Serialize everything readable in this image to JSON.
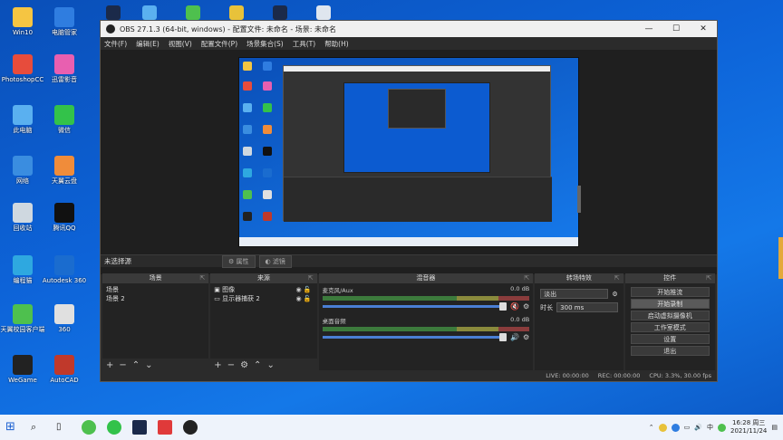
{
  "window": {
    "title": "OBS 27.1.3 (64-bit, windows) - 配置文件: 未命名 - 场景: 未命名",
    "minimize": "—",
    "maximize": "☐",
    "close": "✕"
  },
  "menu": [
    "文件(F)",
    "编辑(E)",
    "视图(V)",
    "配置文件(P)",
    "场景集合(S)",
    "工具(T)",
    "帮助(H)"
  ],
  "context_bar": {
    "no_source": "未选择源",
    "properties": "属性",
    "filters": "滤镜"
  },
  "scenes": {
    "title": "场景",
    "items": [
      "场景",
      "场景 2"
    ]
  },
  "sources": {
    "title": "来源",
    "items": [
      "图像",
      "显示器捕获 2"
    ]
  },
  "mixer": {
    "title": "混音器",
    "tracks": [
      {
        "name": "麦克风/Aux",
        "db": "0.0 dB",
        "muted": true
      },
      {
        "name": "桌面音频",
        "db": "0.0 dB",
        "muted": false
      }
    ]
  },
  "transitions": {
    "title": "转场特效",
    "selected": "淡出",
    "duration_label": "时长",
    "duration_value": "300 ms"
  },
  "controls": {
    "title": "控件",
    "buttons": [
      "开始推流",
      "开始录制",
      "启动虚拟摄像机",
      "工作室模式",
      "设置",
      "退出"
    ]
  },
  "statusbar": {
    "live": "LIVE: 00:00:00",
    "rec": "REC: 00:00:00",
    "cpu": "CPU: 3.3%, 30.00 fps"
  },
  "desktop_icons": [
    {
      "label": "Win10"
    },
    {
      "label": "电脑管家"
    },
    {
      "label": "PhotoshopCC"
    },
    {
      "label": "迅雷影音"
    },
    {
      "label": "此电脑"
    },
    {
      "label": "微信"
    },
    {
      "label": "网络"
    },
    {
      "label": "天翼云盘"
    },
    {
      "label": "回收站"
    },
    {
      "label": "腾讯QQ"
    },
    {
      "label": "编程猫"
    },
    {
      "label": "Autodesk 360"
    },
    {
      "label": "天翼校园客户端"
    },
    {
      "label": "360"
    },
    {
      "label": "WeGame"
    },
    {
      "label": "AutoCAD"
    }
  ],
  "clock": {
    "time": "16:28 周三",
    "date": "2021/11/24"
  },
  "colors": {
    "desktop": "#0d63d8",
    "obs_bg": "#2b2b2b",
    "dock_bg": "#232323",
    "fader": "#4a7fd4"
  }
}
